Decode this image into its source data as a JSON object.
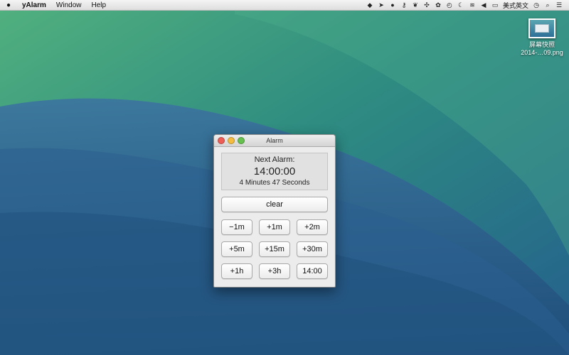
{
  "menubar": {
    "apple_icon": "apple-icon",
    "app_name": "yAlarm",
    "menus": [
      "Window",
      "Help"
    ],
    "status_icons": [
      "evernote-icon",
      "cursor-icon",
      "qq-icon",
      "key-icon",
      "leaf-icon",
      "puzzle-icon",
      "flower-icon",
      "history-icon",
      "moon-icon",
      "wifi-icon",
      "volume-icon",
      "battery-icon"
    ],
    "input_method": "美式英文",
    "right_icons": [
      "clock-icon",
      "search-icon",
      "list-icon"
    ]
  },
  "desktop": {
    "icon_label_line1": "屏幕快照",
    "icon_label_line2": "2014-…09.png"
  },
  "window": {
    "title": "Alarm",
    "display": {
      "label": "Next Alarm:",
      "time": "14:00:00",
      "remaining": "4 Minutes 47 Seconds"
    },
    "clear_label": "clear",
    "buttons": [
      [
        "−1m",
        "+1m",
        "+2m"
      ],
      [
        "+5m",
        "+15m",
        "+30m"
      ],
      [
        "+1h",
        "+3h",
        "14:00"
      ]
    ]
  }
}
